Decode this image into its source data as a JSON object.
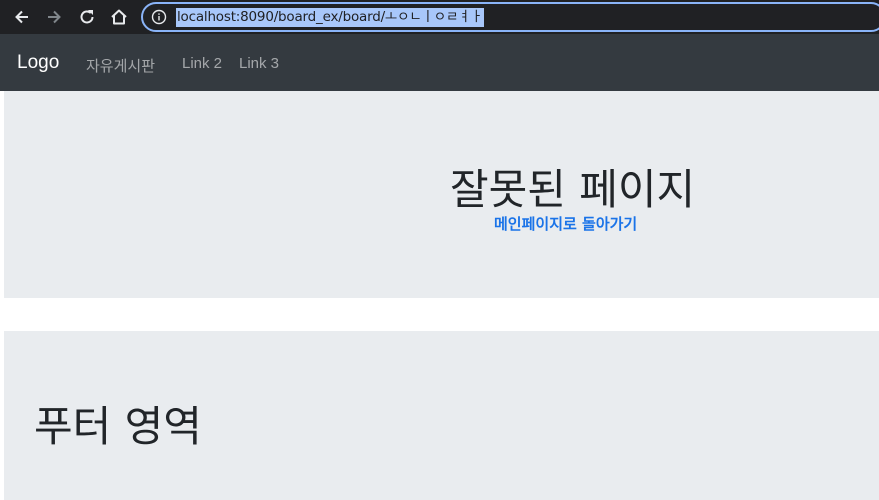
{
  "browser": {
    "url": "localhost:8090/board_ex/board/ㅗㅇㄴㅣㅇㄹㅕㅏ",
    "icons": [
      "back-arrow-icon",
      "forward-arrow-icon",
      "reload-icon",
      "home-icon",
      "info-icon"
    ]
  },
  "navbar": {
    "brand": "Logo",
    "links": [
      "자유게시판",
      "Link 2",
      "Link 3"
    ]
  },
  "error": {
    "title": "잘못된 페이지",
    "back_link": "메인페이지로 돌아가기"
  },
  "footer": {
    "text": "푸터 영역"
  },
  "colors": {
    "browser_bg": "#202124",
    "navbar_bg": "#343a40",
    "jumbotron_bg": "#e9ecef",
    "link_blue": "#1a73e8"
  }
}
